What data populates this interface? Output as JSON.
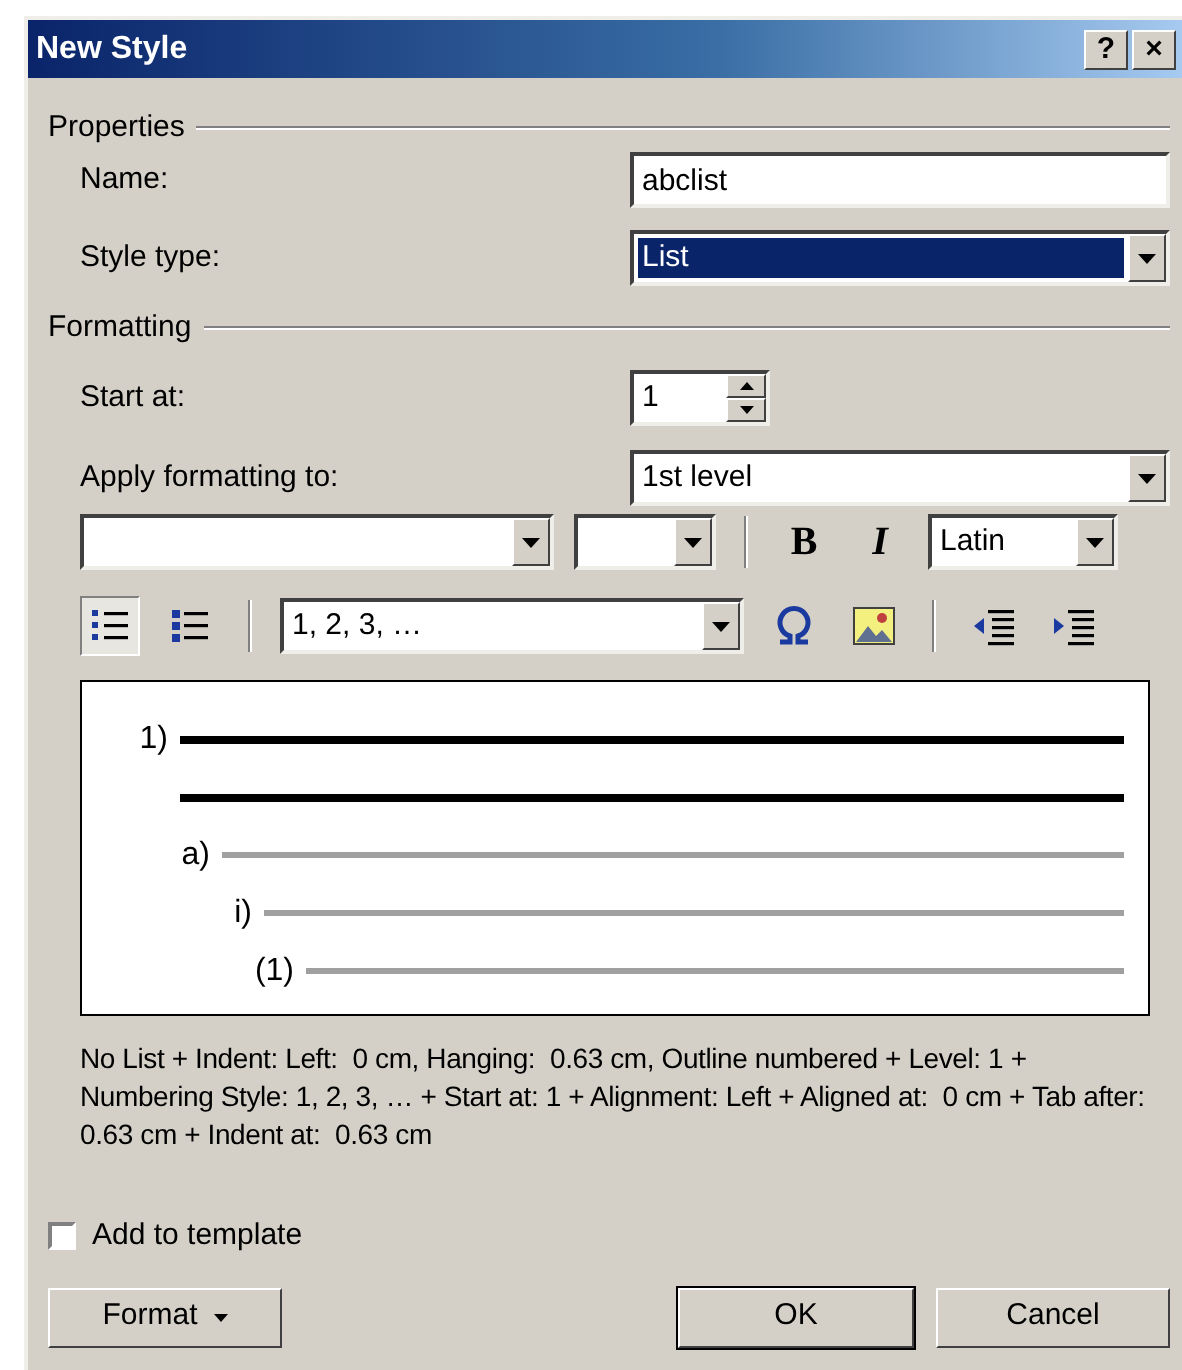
{
  "window": {
    "title": "New Style",
    "buttons": [
      "?",
      "×"
    ]
  },
  "properties": {
    "heading": "Properties",
    "name": {
      "label": "Name:",
      "value": "abclist"
    },
    "style_type": {
      "label": "Style type:",
      "value": "List",
      "selected": true
    }
  },
  "formatting": {
    "heading": "Formatting",
    "start_at": {
      "label": "Start at:",
      "value": "1"
    },
    "apply_to": {
      "label": "Apply formatting to:",
      "value": "1st level"
    },
    "toolbar_1": [
      {
        "kind": "combo"
      },
      {
        "kind": "combo"
      },
      {
        "kind": "separator"
      },
      {
        "kind": "toggle",
        "label": "B",
        "on": false
      },
      {
        "kind": "toggle",
        "label": "I",
        "on": false
      },
      {
        "kind": "combo",
        "value": "Latin"
      }
    ],
    "toolbar_2": [
      {
        "kind": "icon",
        "selected": true
      },
      {
        "kind": "icon",
        "selected": false
      },
      {
        "kind": "separator"
      },
      {
        "kind": "combo",
        "value": "1, 2, 3, …"
      },
      {
        "kind": "icon"
      },
      {
        "kind": "icon"
      },
      {
        "kind": "separator"
      },
      {
        "kind": "icon"
      },
      {
        "kind": "icon"
      }
    ],
    "preview": [
      {
        "label": "1)",
        "selected": true,
        "children": [
          {
            "label": "a)",
            "selected": false,
            "children": [
              {
                "label": "i)",
                "selected": false,
                "children": [
                  {
                    "label": "(1)",
                    "selected": false
                  }
                ]
              }
            ]
          }
        ]
      }
    ],
    "description": "No List + Indent: Left:  0 cm, Hanging:  0.63 cm, Outline numbered + Level: 1 + Numbering Style: 1, 2, 3, … + Start at: 1 + Alignment: Left + Aligned at:  0 cm + Tab after:  0.63 cm + Indent at:  0.63 cm"
  },
  "add_to_template": {
    "label": "Add to template",
    "checked": false
  },
  "buttons": [
    {
      "label": "Format",
      "kind": "menu"
    },
    {
      "label": "OK",
      "kind": "default"
    },
    {
      "label": "Cancel",
      "kind": "normal"
    }
  ]
}
